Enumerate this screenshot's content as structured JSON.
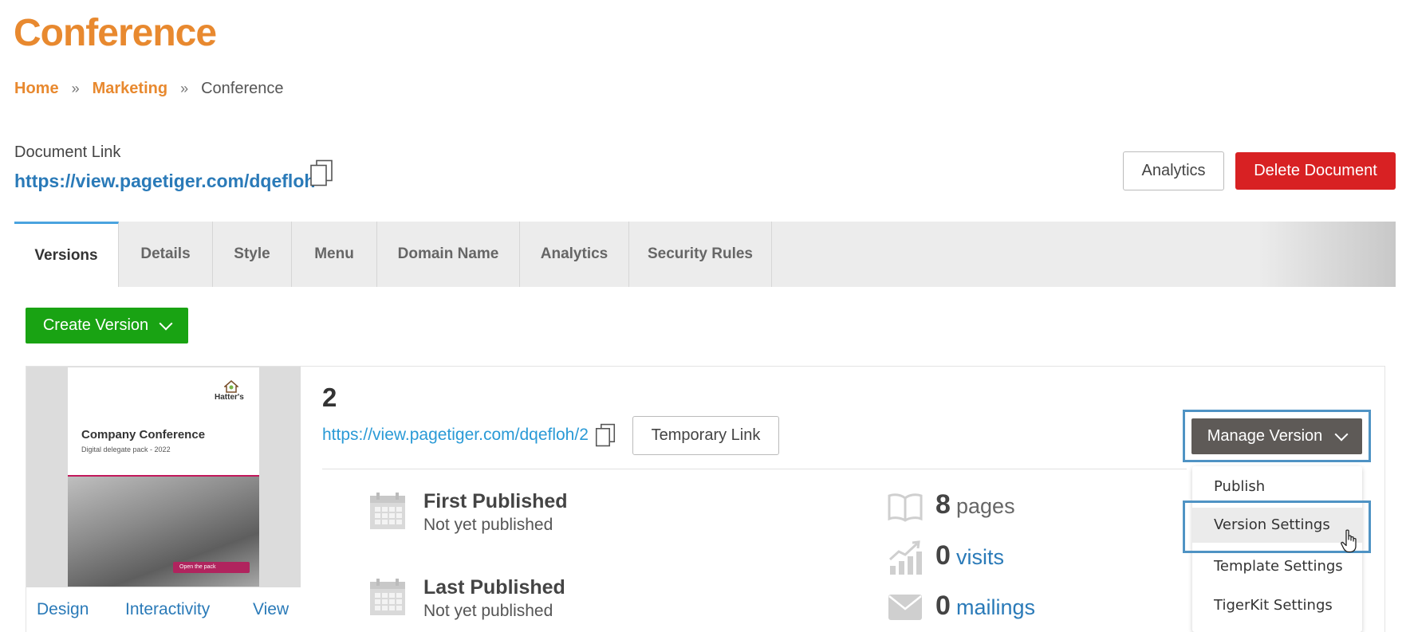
{
  "page": {
    "title": "Conference"
  },
  "breadcrumb": {
    "home": "Home",
    "marketing": "Marketing",
    "current": "Conference",
    "separator": "»"
  },
  "document_link": {
    "label": "Document Link",
    "url": "https://view.pagetiger.com/dqefloh"
  },
  "header_buttons": {
    "analytics": "Analytics",
    "delete": "Delete Document"
  },
  "tabs": [
    {
      "label": "Versions",
      "active": true
    },
    {
      "label": "Details"
    },
    {
      "label": "Style"
    },
    {
      "label": "Menu"
    },
    {
      "label": "Domain Name"
    },
    {
      "label": "Analytics"
    },
    {
      "label": "Security Rules"
    }
  ],
  "create_version": {
    "label": "Create Version"
  },
  "version": {
    "number": "2",
    "url": "https://view.pagetiger.com/dqefloh/2",
    "temporary_link_label": "Temporary Link",
    "thumbnail": {
      "brand": "Hatter's",
      "title": "Company Conference",
      "subtitle": "Digital delegate pack - 2022",
      "button": "Open the pack"
    },
    "thumb_links": {
      "design": "Design",
      "interactivity": "Interactivity",
      "view": "View"
    },
    "first_published": {
      "title": "First Published",
      "value": "Not yet published"
    },
    "last_published": {
      "title": "Last Published",
      "value": "Not yet published"
    },
    "stats": {
      "pages": {
        "count": "8",
        "label": "pages"
      },
      "visits": {
        "count": "0",
        "label": "visits"
      },
      "mailings": {
        "count": "0",
        "label": "mailings"
      }
    }
  },
  "manage_version": {
    "label": "Manage Version",
    "menu": [
      "Publish",
      "Version Settings",
      "Template Settings",
      "TigerKit Settings"
    ],
    "hovered": "Version Settings"
  },
  "colors": {
    "accent_orange": "#e8892f",
    "link_blue": "#2a7ab8",
    "delete_red": "#d82123",
    "create_green": "#19a313",
    "manage_gray": "#5e5a57",
    "highlight_blue": "#4f93c4"
  }
}
